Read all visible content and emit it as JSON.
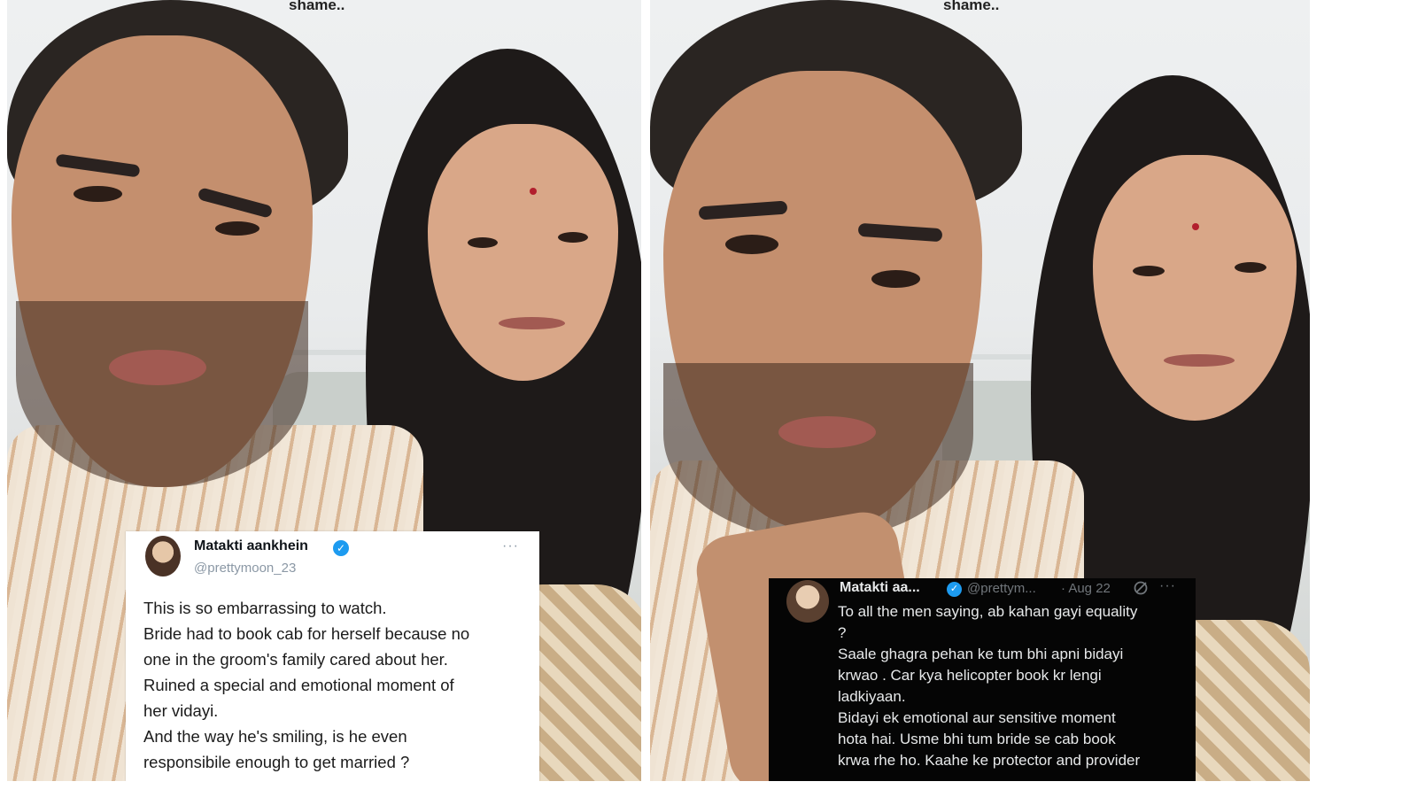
{
  "left_panel": {
    "caption": "shame..",
    "tweet": {
      "name": "Matakti aankhein",
      "verified_icon": "verified-badge-icon",
      "handle": "@prettymoon_23",
      "more_icon": "more-icon",
      "more": "···",
      "lines": [
        "This is so embarrassing to watch.",
        "Bride had to book cab for herself because no",
        "one in the groom's family cared about her.",
        "Ruined a special and emotional moment of",
        "her vidayi.",
        "And the way he's smiling, is he even",
        "responsibile enough to get married ?"
      ]
    }
  },
  "right_panel": {
    "caption": "shame..",
    "tweet": {
      "name": "Matakti aa...",
      "verified_icon": "verified-badge-icon",
      "handle": "@prettym...",
      "date": "· Aug 22",
      "more": "···",
      "lines": [
        "To all the men saying, ab kahan gayi equality",
        "?",
        "Saale ghagra pehan ke tum bhi apni bidayi",
        "krwao . Car kya helicopter book kr lengi",
        "ladkiyaan.",
        "Bidayi ek emotional aur sensitive moment",
        "hota hai. Usme bhi tum bride se cab book",
        "krwa rhe ho. Kaahe ke protector and provider"
      ]
    }
  },
  "colors": {
    "verified": "#1d9bf0",
    "dark_card": "#050505",
    "light_card": "#ffffff"
  }
}
